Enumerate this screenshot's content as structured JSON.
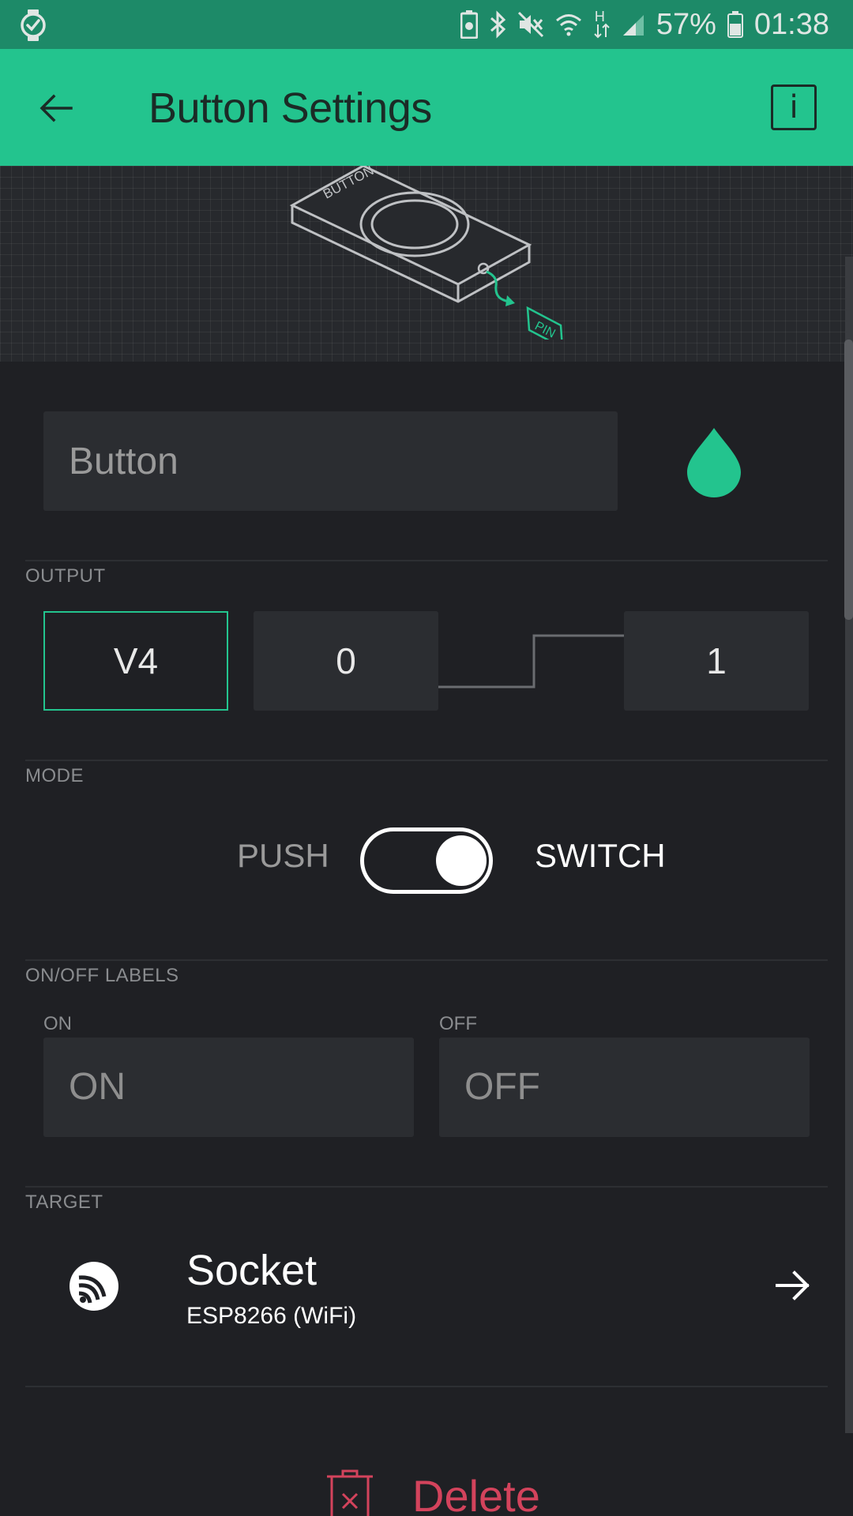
{
  "status_bar": {
    "battery_percent": "57%",
    "time": "01:38",
    "network_type": "H",
    "icons": [
      "watch-check-icon",
      "battery-saver-icon",
      "bluetooth-icon",
      "mute-icon",
      "wifi-icon",
      "network-type-icon",
      "signal-icon",
      "battery-icon"
    ]
  },
  "app_bar": {
    "title": "Button Settings",
    "back_icon": "arrow-left-icon",
    "info_label": "i"
  },
  "hero": {
    "illustration": "button-device-illustration",
    "device_label": "BUTTON",
    "pin_label": "PIN"
  },
  "name_field": {
    "placeholder": "Button",
    "color_icon": "color-drop-icon",
    "color": "#23c48e"
  },
  "output": {
    "section_label": "OUTPUT",
    "pin": "V4",
    "low_value": "0",
    "high_value": "1"
  },
  "mode": {
    "section_label": "MODE",
    "option_left": "PUSH",
    "option_right": "SWITCH",
    "selected": "SWITCH"
  },
  "labels": {
    "section_label": "ON/OFF LABELS",
    "on_caption": "ON",
    "off_caption": "OFF",
    "on_placeholder": "ON",
    "off_placeholder": "OFF"
  },
  "target": {
    "section_label": "TARGET",
    "name": "Socket",
    "device": "ESP8266 (WiFi)",
    "device_icon": "esp-chip-icon",
    "arrow_icon": "arrow-right-icon"
  },
  "footer": {
    "delete_label": "Delete",
    "delete_icon": "trash-icon",
    "delete_color": "#d3435c"
  },
  "colors": {
    "accent": "#23c48e",
    "status_bar": "#1d8a68",
    "background": "#1f2024"
  }
}
